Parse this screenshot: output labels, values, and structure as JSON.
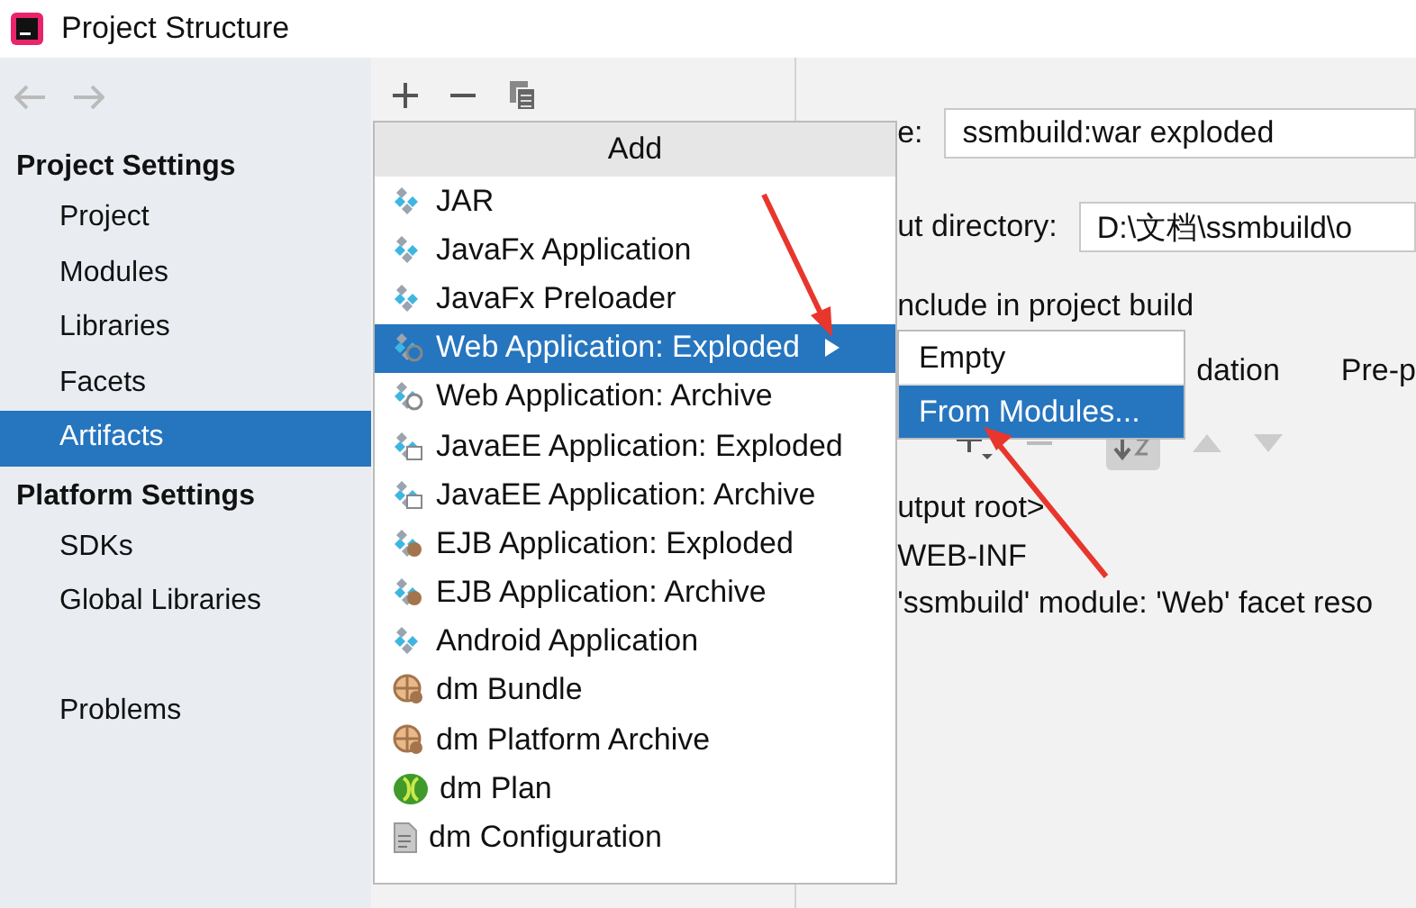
{
  "window": {
    "title": "Project Structure"
  },
  "sidebar": {
    "sections": [
      {
        "heading": "Project Settings",
        "items": [
          {
            "label": "Project",
            "selected": false
          },
          {
            "label": "Modules",
            "selected": false
          },
          {
            "label": "Libraries",
            "selected": false
          },
          {
            "label": "Facets",
            "selected": false
          },
          {
            "label": "Artifacts",
            "selected": true
          }
        ]
      },
      {
        "heading": "Platform Settings",
        "items": [
          {
            "label": "SDKs",
            "selected": false
          },
          {
            "label": "Global Libraries",
            "selected": false
          }
        ]
      }
    ],
    "problems": {
      "label": "Problems",
      "selected": false
    }
  },
  "toolbar": {
    "buttons": [
      {
        "kind": "add"
      },
      {
        "kind": "remove"
      },
      {
        "kind": "copy"
      }
    ]
  },
  "details": {
    "name_label": "e:",
    "name_value": "ssmbuild:war exploded",
    "output_label": "ut directory:",
    "output_value": "D:\\文档\\ssmbuild\\o",
    "include_label": "nclude in project build",
    "tabs": [
      {
        "label": "dation",
        "selected": false
      },
      {
        "label": "Pre-p",
        "selected": false
      }
    ],
    "tree": [
      "utput root>",
      "WEB-INF",
      "'ssmbuild' module: 'Web' facet reso"
    ]
  },
  "add_menu": {
    "title": "Add",
    "items": [
      {
        "label": "JAR",
        "kind": "artifact",
        "selected": false,
        "submenu": false
      },
      {
        "label": "JavaFx Application",
        "kind": "artifact",
        "selected": false,
        "submenu": false
      },
      {
        "label": "JavaFx Preloader",
        "kind": "artifact",
        "selected": false,
        "submenu": false
      },
      {
        "label": "Web Application: Exploded",
        "kind": "web",
        "selected": true,
        "submenu": true
      },
      {
        "label": "Web Application: Archive",
        "kind": "web",
        "selected": false,
        "submenu": false
      },
      {
        "label": "JavaEE Application: Exploded",
        "kind": "javaee",
        "selected": false,
        "submenu": false
      },
      {
        "label": "JavaEE Application: Archive",
        "kind": "javaee",
        "selected": false,
        "submenu": false
      },
      {
        "label": "EJB Application: Exploded",
        "kind": "ejb",
        "selected": false,
        "submenu": false
      },
      {
        "label": "EJB Application: Archive",
        "kind": "ejb",
        "selected": false,
        "submenu": false
      },
      {
        "label": "Android Application",
        "kind": "artifact",
        "selected": false,
        "submenu": false
      },
      {
        "label": "dm Bundle",
        "kind": "bundle",
        "selected": false,
        "submenu": false
      },
      {
        "label": "dm Platform Archive",
        "kind": "bundle",
        "selected": false,
        "submenu": false
      },
      {
        "label": "dm Plan",
        "kind": "plan",
        "selected": false,
        "submenu": false
      },
      {
        "label": "dm Configuration",
        "kind": "file",
        "selected": false,
        "submenu": false
      }
    ]
  },
  "submenu": {
    "items": [
      {
        "label": "Empty",
        "selected": false
      },
      {
        "label": "From Modules...",
        "selected": true
      }
    ]
  }
}
